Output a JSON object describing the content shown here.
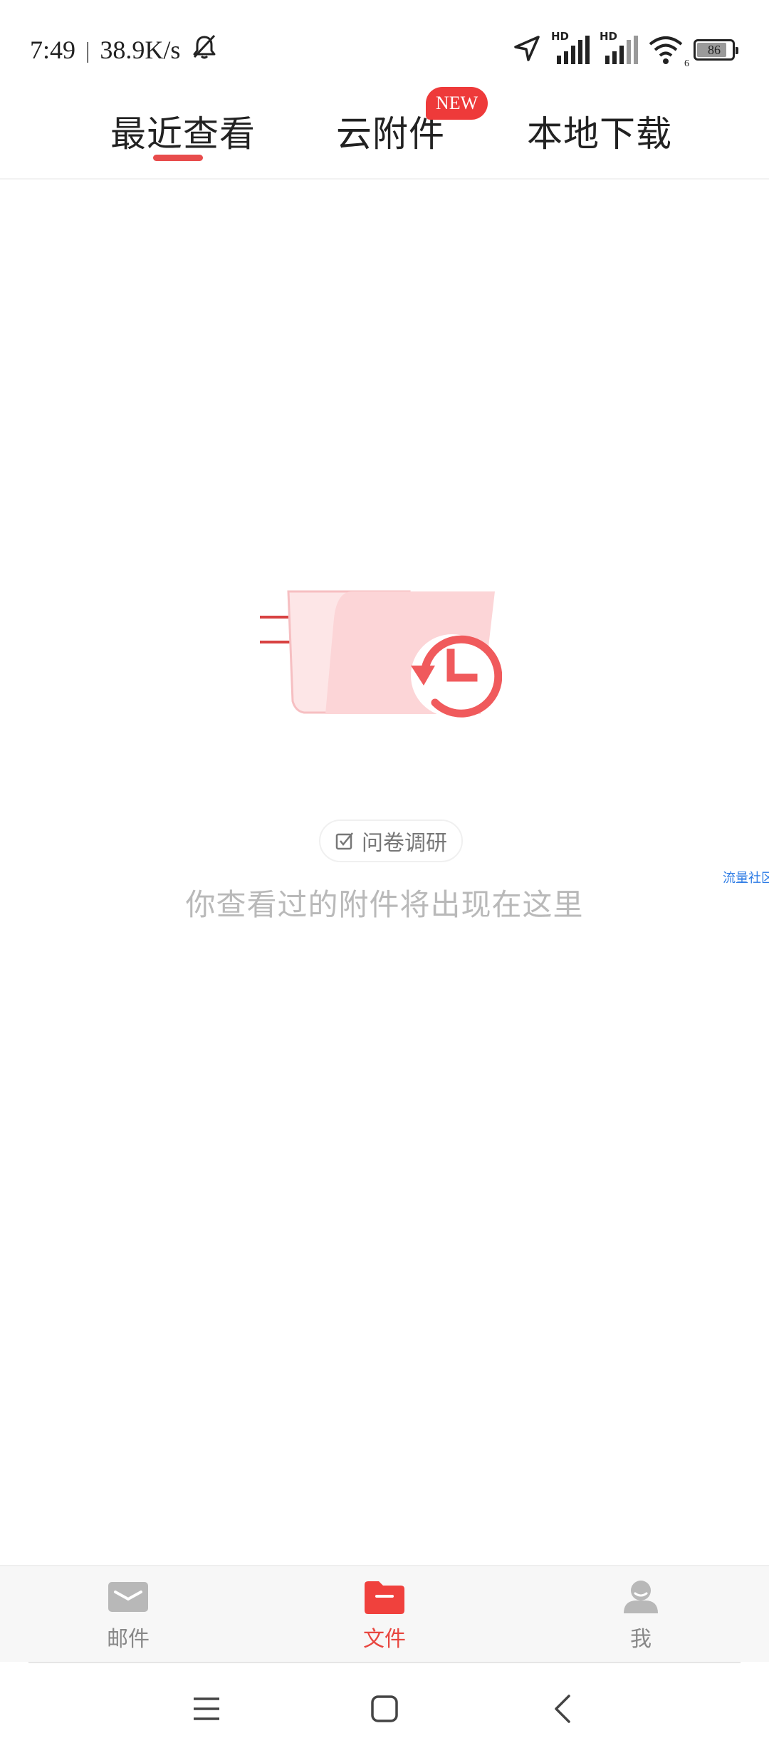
{
  "status_bar": {
    "time": "7:49",
    "separator": "|",
    "speed": "38.9K/s",
    "hd1": "HD",
    "hd2": "HD",
    "wifi_sub": "6",
    "battery": "86",
    "battery_level_percent": 86,
    "icons": [
      "bell-off-icon",
      "location-arrow-icon",
      "signal-icon",
      "signal-icon",
      "wifi-icon",
      "battery-icon"
    ]
  },
  "tabs": [
    {
      "label": "最近查看",
      "active": true
    },
    {
      "label": "云附件",
      "badge": "NEW"
    },
    {
      "label": "本地下载"
    }
  ],
  "empty_state": {
    "survey_label": "问卷调研",
    "message": "你查看过的附件将出现在这里",
    "edge_text": "流量社区",
    "illustration_icon": "recent-file-history-icon"
  },
  "bottom_nav": [
    {
      "label": "邮件",
      "icon": "mail-icon",
      "active": false
    },
    {
      "label": "文件",
      "icon": "folder-icon",
      "active": true
    },
    {
      "label": "我",
      "icon": "profile-icon",
      "active": false
    }
  ],
  "system_nav": {
    "icons": [
      "menu-icon",
      "home-icon",
      "back-icon"
    ]
  },
  "colors": {
    "accent": "#e84c4c",
    "badge": "#ee3a3a",
    "illustration_light": "#fcd5d7",
    "illustration_strong": "#f05a5c",
    "muted_text": "#b9b9b9",
    "nav_bg": "#f7f7f7"
  }
}
